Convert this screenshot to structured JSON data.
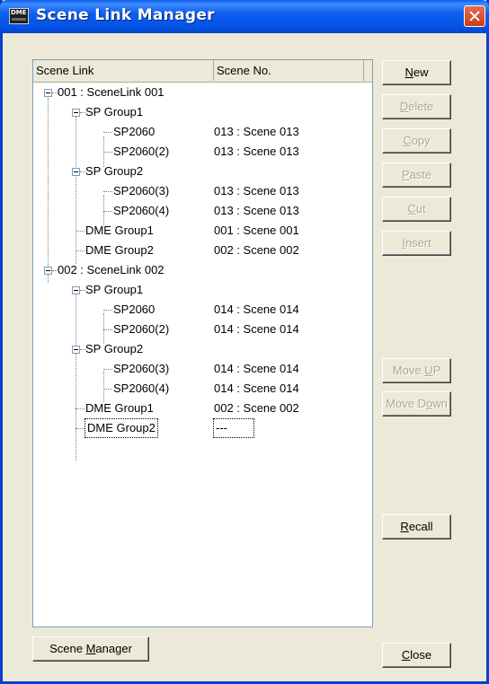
{
  "window": {
    "title": "Scene Link Manager",
    "icon_label": "DME",
    "close_icon": "close-icon"
  },
  "tree": {
    "columns": [
      "Scene Link",
      "Scene No."
    ],
    "rows": [
      {
        "label": "001 : SceneLink 001",
        "scene": ""
      },
      {
        "label": "SP Group1",
        "scene": ""
      },
      {
        "label": "SP2060",
        "scene": "013 : Scene 013"
      },
      {
        "label": "SP2060(2)",
        "scene": "013 : Scene 013"
      },
      {
        "label": "SP Group2",
        "scene": ""
      },
      {
        "label": "SP2060(3)",
        "scene": "013 : Scene 013"
      },
      {
        "label": "SP2060(4)",
        "scene": "013 : Scene 013"
      },
      {
        "label": "DME Group1",
        "scene": "001 : Scene 001"
      },
      {
        "label": "DME Group2",
        "scene": "002 : Scene 002"
      },
      {
        "label": "002 : SceneLink 002",
        "scene": ""
      },
      {
        "label": "SP Group1",
        "scene": ""
      },
      {
        "label": "SP2060",
        "scene": "014 : Scene 014"
      },
      {
        "label": "SP2060(2)",
        "scene": "014 : Scene 014"
      },
      {
        "label": "SP Group2",
        "scene": ""
      },
      {
        "label": "SP2060(3)",
        "scene": "014 : Scene 014"
      },
      {
        "label": "SP2060(4)",
        "scene": "014 : Scene 014"
      },
      {
        "label": "DME Group1",
        "scene": "002 : Scene 002"
      },
      {
        "label": "DME Group2",
        "scene": "---"
      }
    ]
  },
  "buttons": {
    "new": {
      "pre": "",
      "key": "N",
      "post": "ew"
    },
    "delete": {
      "pre": "",
      "key": "D",
      "post": "elete"
    },
    "copy": {
      "pre": "",
      "key": "C",
      "post": "opy"
    },
    "paste": {
      "pre": "",
      "key": "P",
      "post": "aste"
    },
    "cut": {
      "pre": "",
      "key": "C",
      "post": "ut"
    },
    "insert": {
      "pre": "",
      "key": "I",
      "post": "nsert"
    },
    "move_up": {
      "pre": "Move ",
      "key": "U",
      "post": "P"
    },
    "move_down": {
      "pre": "Move D",
      "key": "o",
      "post": "wn"
    },
    "recall": {
      "pre": "",
      "key": "R",
      "post": "ecall"
    },
    "scene_manager": {
      "pre": "Scene ",
      "key": "M",
      "post": "anager"
    },
    "close": {
      "pre": "",
      "key": "C",
      "post": "lose"
    }
  }
}
